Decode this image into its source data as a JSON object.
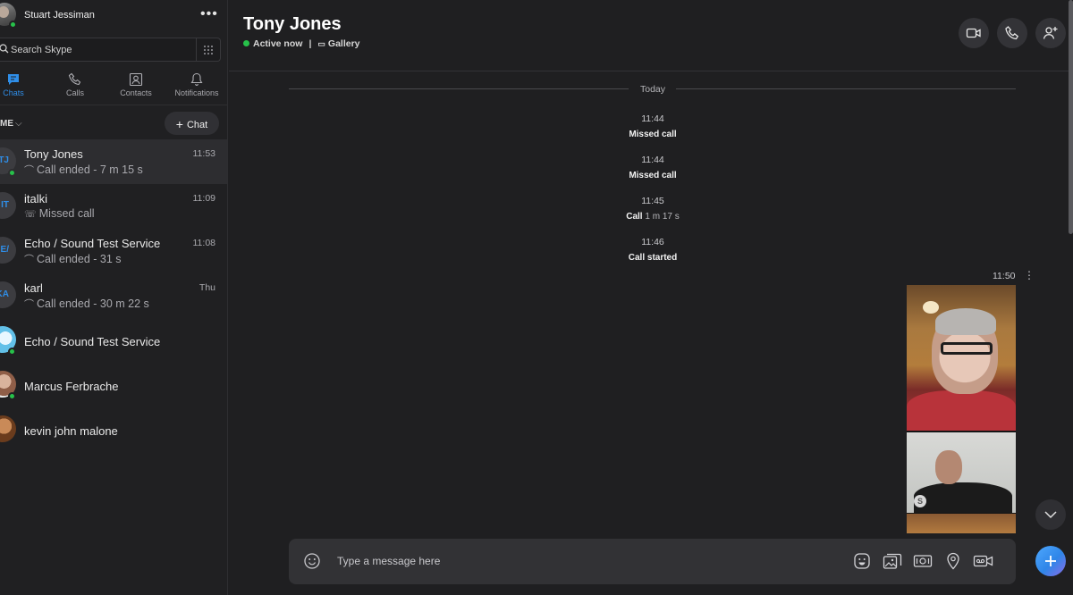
{
  "profile": {
    "name": "Stuart Jessiman",
    "more": "•••"
  },
  "search": {
    "placeholder": "Search Skype"
  },
  "nav": {
    "items": [
      {
        "label": "Chats",
        "icon": "chat-icon",
        "active": true
      },
      {
        "label": "Calls",
        "icon": "phone-icon",
        "active": false
      },
      {
        "label": "Contacts",
        "icon": "contacts-icon",
        "active": false
      },
      {
        "label": "Notifications",
        "icon": "bell-icon",
        "active": false
      }
    ]
  },
  "list_header": {
    "label": "ME",
    "chevron": "⌵",
    "new_chat": "Chat"
  },
  "chats": [
    {
      "initials": "TJ",
      "name": "Tony Jones",
      "subtitle": "Call ended - 7 m 15 s",
      "sub_icon": "⌒",
      "time": "11:53",
      "online": true,
      "selected": true
    },
    {
      "initials": "IT",
      "name": "italki",
      "subtitle": "Missed call",
      "sub_icon": "☏",
      "time": "11:09",
      "online": false,
      "selected": false
    },
    {
      "initials": "E/",
      "name": "Echo / Sound Test Service",
      "subtitle": "Call ended - 31 s",
      "sub_icon": "⌒",
      "time": "11:08",
      "online": false,
      "selected": false
    },
    {
      "initials": "KA",
      "name": "karl",
      "subtitle": "Call ended - 30 m 22 s",
      "sub_icon": "⌒",
      "time": "Thu",
      "online": false,
      "selected": false
    },
    {
      "initials": "",
      "name": "Echo / Sound Test Service",
      "subtitle": "",
      "time": "",
      "online": true,
      "selected": false
    },
    {
      "initials": "",
      "name": "Marcus Ferbrache",
      "subtitle": "",
      "time": "",
      "online": true,
      "selected": false
    },
    {
      "initials": "",
      "name": "kevin john malone",
      "subtitle": "",
      "time": "",
      "online": false,
      "selected": false
    }
  ],
  "conversation_header": {
    "name": "Tony Jones",
    "status": "Active now",
    "separator": "|",
    "gallery": "Gallery"
  },
  "conversation": {
    "date_divider": "Today",
    "events": [
      {
        "time": "11:44",
        "text": "Missed call",
        "duration": ""
      },
      {
        "time": "11:44",
        "text": "Missed call",
        "duration": ""
      },
      {
        "time": "11:45",
        "text": "Call",
        "duration": "1 m 17 s"
      },
      {
        "time": "11:46",
        "text": "Call started",
        "duration": ""
      }
    ],
    "video_message": {
      "time": "11:50",
      "menu": "⋮"
    }
  },
  "composer": {
    "placeholder": "Type a message here"
  },
  "colors": {
    "accent": "#2f8ee8",
    "online": "#27c14a",
    "background": "#1f1f21",
    "sidebar": "#202022"
  }
}
